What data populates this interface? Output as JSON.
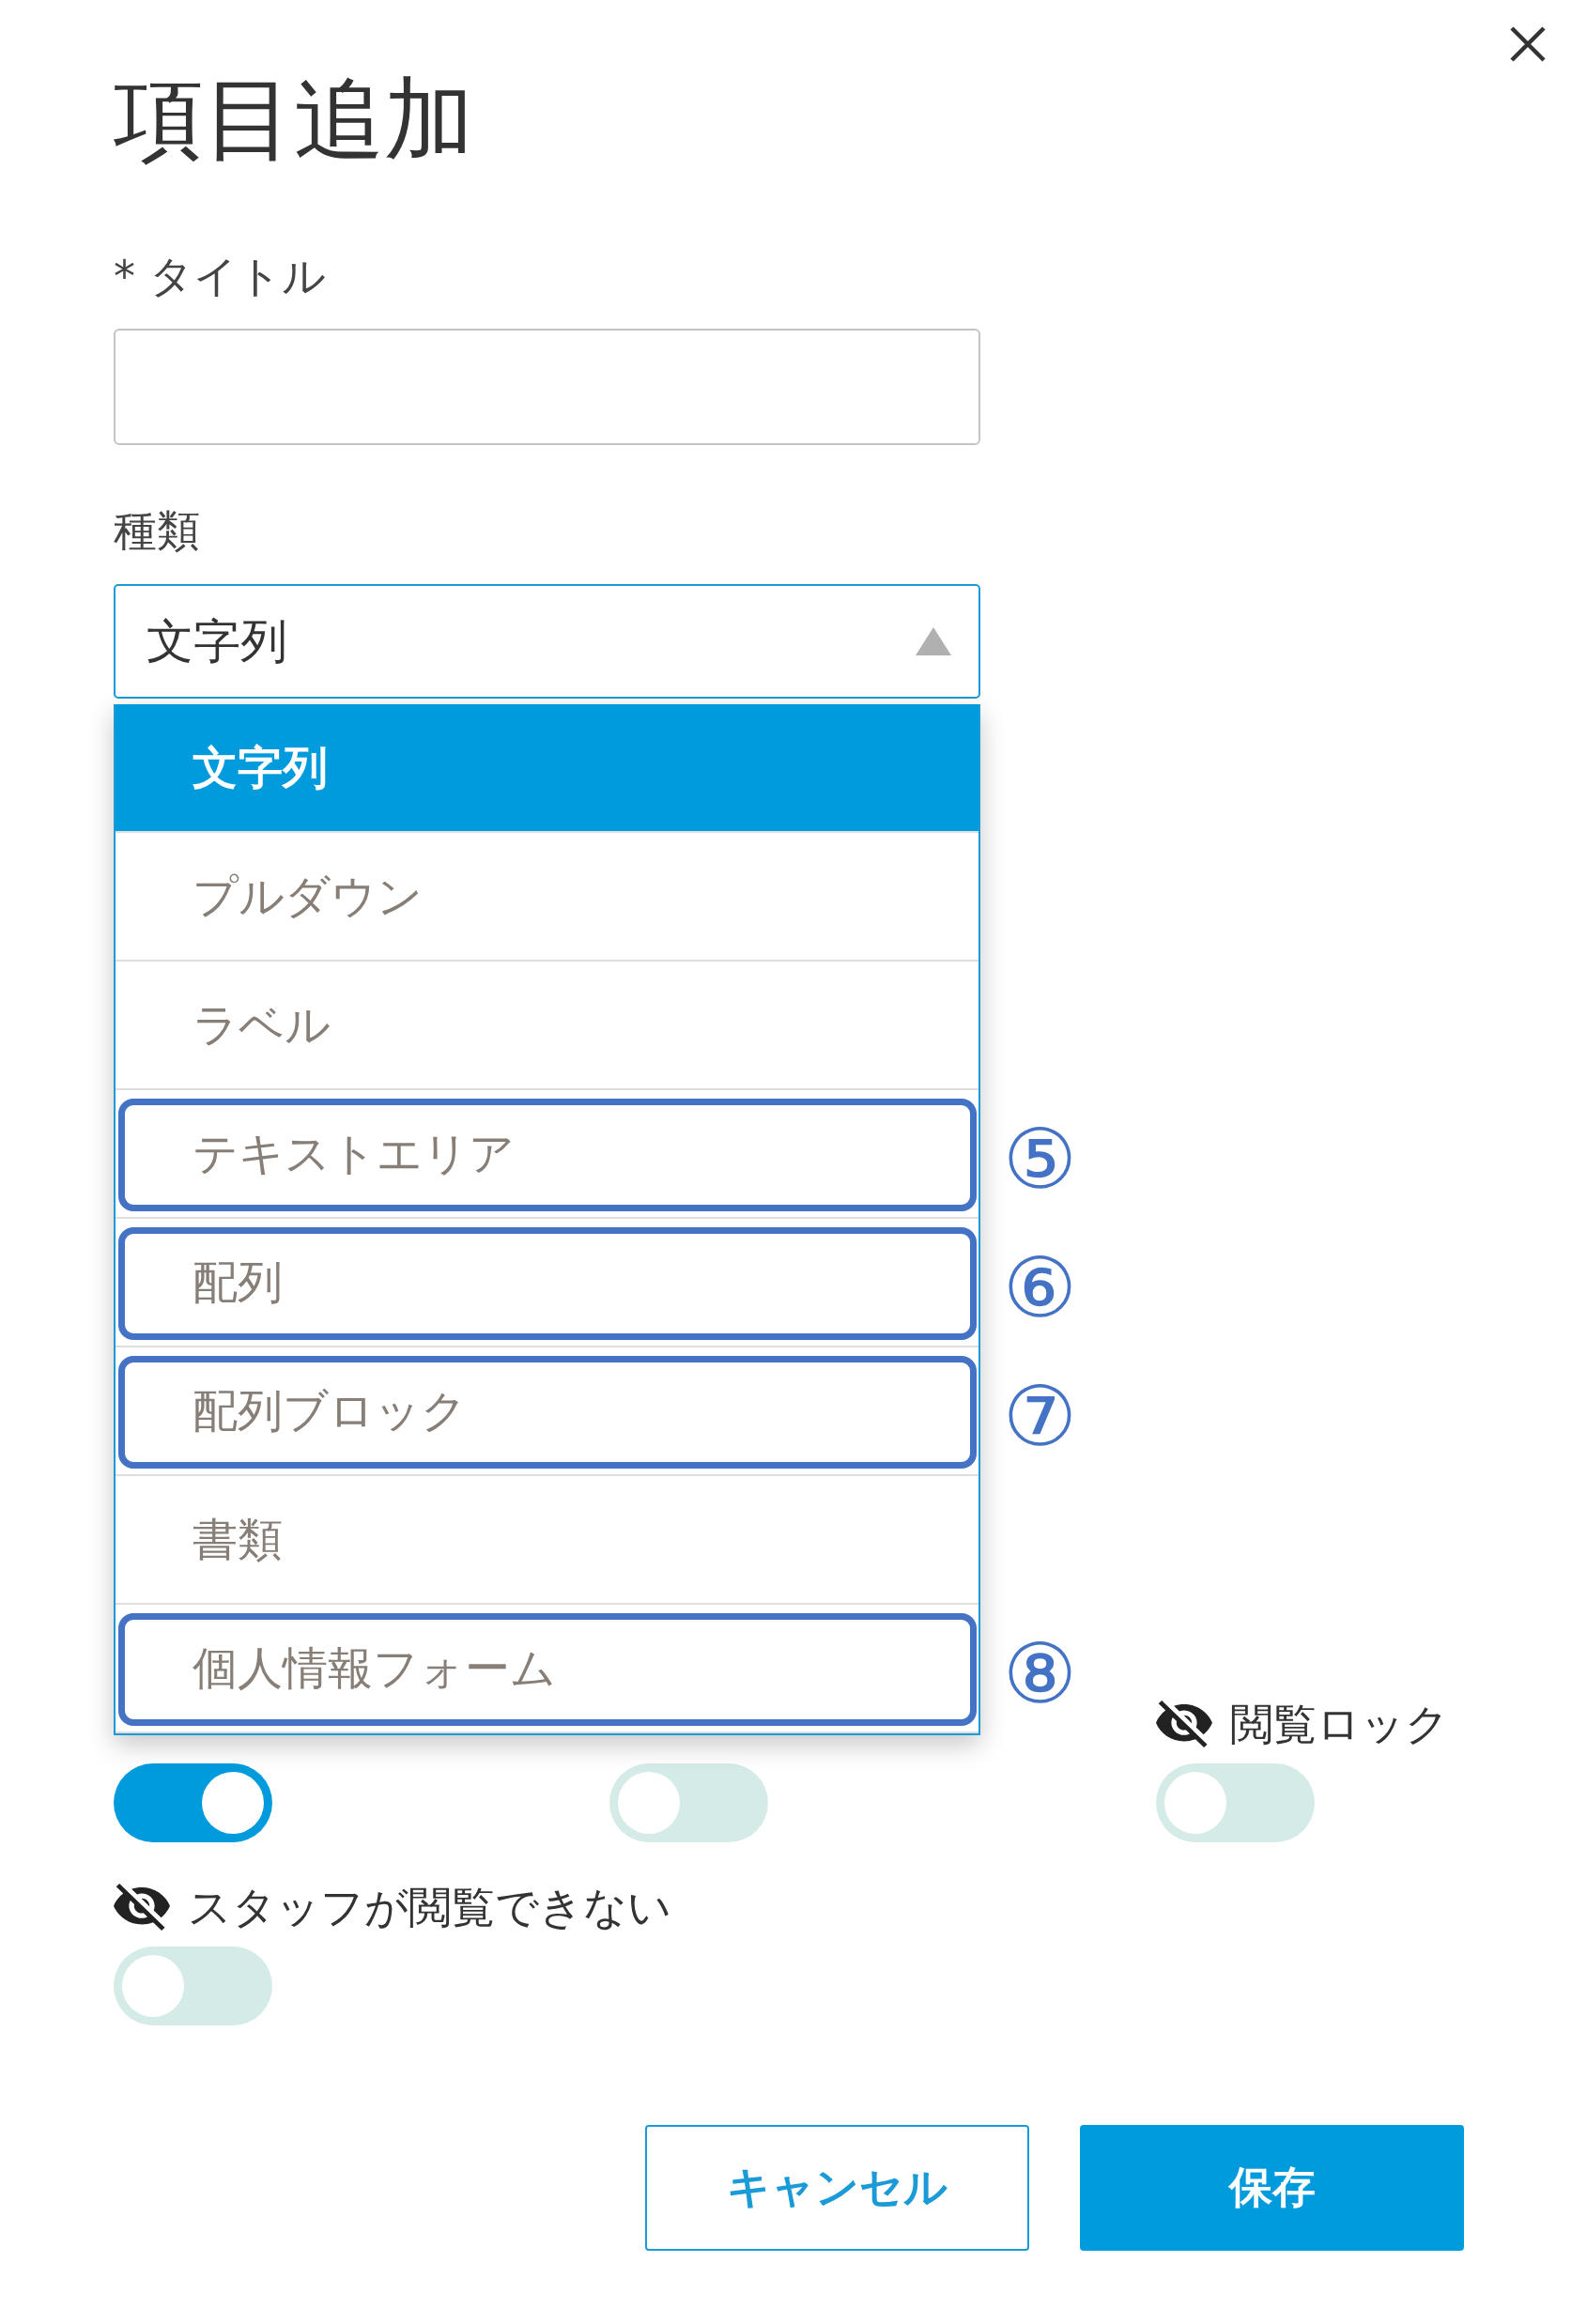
{
  "dialog": {
    "title": "項目追加"
  },
  "fields": [
    {
      "kind": "text",
      "label": "* タイトル"
    },
    {
      "kind": "select",
      "label": "種類",
      "value": "文字列",
      "expanded": true,
      "options": [
        {
          "label": "文字列",
          "selected": true,
          "highlighted": false
        },
        {
          "label": "プルダウン",
          "selected": false,
          "highlighted": false
        },
        {
          "label": "ラベル",
          "selected": false,
          "highlighted": false
        },
        {
          "label": "テキストエリア",
          "selected": false,
          "highlighted": true,
          "marker": "⑤"
        },
        {
          "label": "配列",
          "selected": false,
          "highlighted": true,
          "marker": "⑥"
        },
        {
          "label": "配列ブロック",
          "selected": false,
          "highlighted": true,
          "marker": "⑦"
        },
        {
          "label": "書類",
          "selected": false,
          "highlighted": false
        },
        {
          "label": "個人情報フォーム",
          "selected": false,
          "highlighted": true,
          "marker": "⑧"
        }
      ]
    }
  ],
  "toggles": [
    {
      "kind": "plain",
      "on": true
    },
    {
      "kind": "plain",
      "on": false
    },
    {
      "kind": "visibility",
      "label": "閲覧ロック",
      "on": false
    },
    {
      "kind": "visibility",
      "label": "スタッフが閲覧できない",
      "on": false
    }
  ],
  "buttons": [
    {
      "kind": "secondary",
      "label": "キャンセル"
    },
    {
      "kind": "primary",
      "label": "保存"
    }
  ]
}
